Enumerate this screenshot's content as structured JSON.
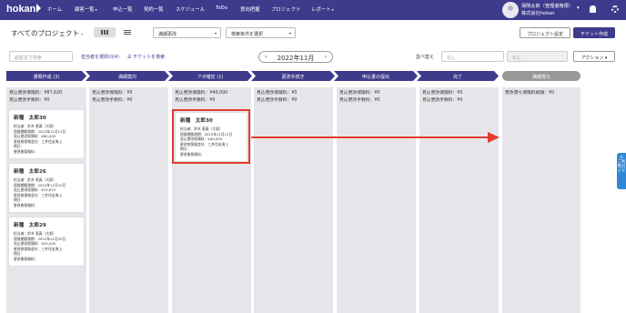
{
  "nav": {
    "logo": "hokan",
    "items": [
      {
        "label": "ホーム",
        "dropdown": ""
      },
      {
        "label": "顧客一覧",
        "dropdown": "▾"
      },
      {
        "label": "申込一覧",
        "dropdown": ""
      },
      {
        "label": "契約一覧",
        "dropdown": ""
      },
      {
        "label": "スケジュール",
        "dropdown": ""
      },
      {
        "label": "ToDo",
        "dropdown": ""
      },
      {
        "label": "意向把握",
        "dropdown": ""
      },
      {
        "label": "プロジェクト",
        "dropdown": ""
      },
      {
        "label": "レポート",
        "dropdown": "▾"
      }
    ],
    "user_name": "保険太郎（管理者権限）",
    "company": "株式会社hokan",
    "user_dd": "▾"
  },
  "toolbar": {
    "title": "すべてのプロジェクト",
    "title_dd": "▾",
    "sort_select": "満期更改",
    "sort_dd": "▾",
    "filter_select": "検索条件を選択",
    "filter_dd": "▾",
    "settings_btn": "プロジェクト設定",
    "ticket_btn": "チケット作成"
  },
  "filters": {
    "search_placeholder": "顧客名で検索",
    "assignee": "担当者を選択(0/4)",
    "ticket_search": "チケットを検索",
    "month": "2022年11月",
    "prev": "‹",
    "next": "›",
    "sort_label": "並べ替え",
    "sort_value": "なし",
    "sort_value2": "なし",
    "action_btn": "アクション ▾"
  },
  "stages": [
    "書類作成 (3)",
    "満期案内",
    "アポ確定 (1)",
    "更改手続き",
    "申込書の提出",
    "完了",
    "満期落ち"
  ],
  "columns": [
    {
      "sum1": "見込更改保険料：¥87,620",
      "sum2": "見込更改手数料：¥0"
    },
    {
      "sum1": "見込更改保険料：¥0",
      "sum2": "見込更改手数料：¥0"
    },
    {
      "sum1": "見込更改保険料：¥40,000",
      "sum2": "見込更改手数料：¥0"
    },
    {
      "sum1": "見込更改保険料：¥0",
      "sum2": "見込更改手数料：¥0"
    },
    {
      "sum1": "見込更改保険料：¥0",
      "sum2": "見込更改手数料：¥0"
    },
    {
      "sum1": "見込更改保険料：¥0",
      "sum2": "見込更改手数料：¥0"
    },
    {
      "sum1": "更改落ち保険料総額：¥0",
      "sum2": ""
    }
  ],
  "cards": [
    {
      "name": "新種　太郎30",
      "r1": "担当者：鈴木 恵真（大阪）",
      "r2": "保険期間満期：2022年11月12日",
      "r3": "見込更改保険料：¥60,000",
      "r4": "更改前保険会社：三井住友海上",
      "r5": "期日：",
      "r6": "更改後保険料："
    },
    {
      "name": "新種　太郎26",
      "r1": "担当者：鈴木 恵真（大阪）",
      "r2": "保険期間満期：2022年11月20日",
      "r3": "見込更改保険料：¥10,670",
      "r4": "更改前保険会社：三井住友海上",
      "r5": "期日：",
      "r6": "更改後保険料："
    },
    {
      "name": "新種　太郎29",
      "r1": "担当者：鈴木 恵真（大阪）",
      "r2": "保険期間満期：2022年11月30日",
      "r3": "見込更改保険料：¥20,000",
      "r4": "更改前保険会社：三井住友海上",
      "r5": "期日：",
      "r6": "更改後保険料："
    },
    {
      "name": "新種　太郎30",
      "r1": "担当者：鈴木 恵真（大阪）",
      "r2": "保険期間満期：2022年11月12日",
      "r3": "見込更改保険料：¥40,000",
      "r4": "更改前保険会社：三井住友海上",
      "r5": "期日：",
      "r6": "更改後保険料："
    }
  ],
  "guide": "ご利用ガイド",
  "colors": {
    "nav": "#3e3a8c",
    "highlight": "#e53b2e",
    "guide": "#2f87d6"
  }
}
